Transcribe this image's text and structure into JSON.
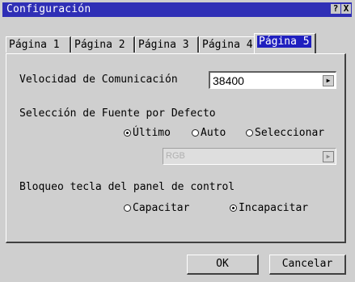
{
  "window": {
    "title": "Configuración",
    "help_label": "?",
    "close_label": "X"
  },
  "tabs": [
    {
      "label": "Página 1",
      "active": false
    },
    {
      "label": "Página 2",
      "active": false
    },
    {
      "label": "Página 3",
      "active": false
    },
    {
      "label": "Página 4",
      "active": false
    },
    {
      "label": "Página 5",
      "active": true
    }
  ],
  "comm_speed": {
    "label": "Velocidad de Comunicación",
    "value": "38400"
  },
  "source_default": {
    "label": "Selección de Fuente por Defecto",
    "options": [
      {
        "label": "Último",
        "selected": true
      },
      {
        "label": "Auto",
        "selected": false
      },
      {
        "label": "Seleccionar",
        "selected": false
      }
    ],
    "source_value": "RGB"
  },
  "panel_lock": {
    "label": "Bloqueo tecla del panel de control",
    "options": [
      {
        "label": "Capacitar",
        "selected": false
      },
      {
        "label": "Incapacitar",
        "selected": true
      }
    ]
  },
  "buttons": {
    "ok": "OK",
    "cancel": "Cancelar"
  }
}
